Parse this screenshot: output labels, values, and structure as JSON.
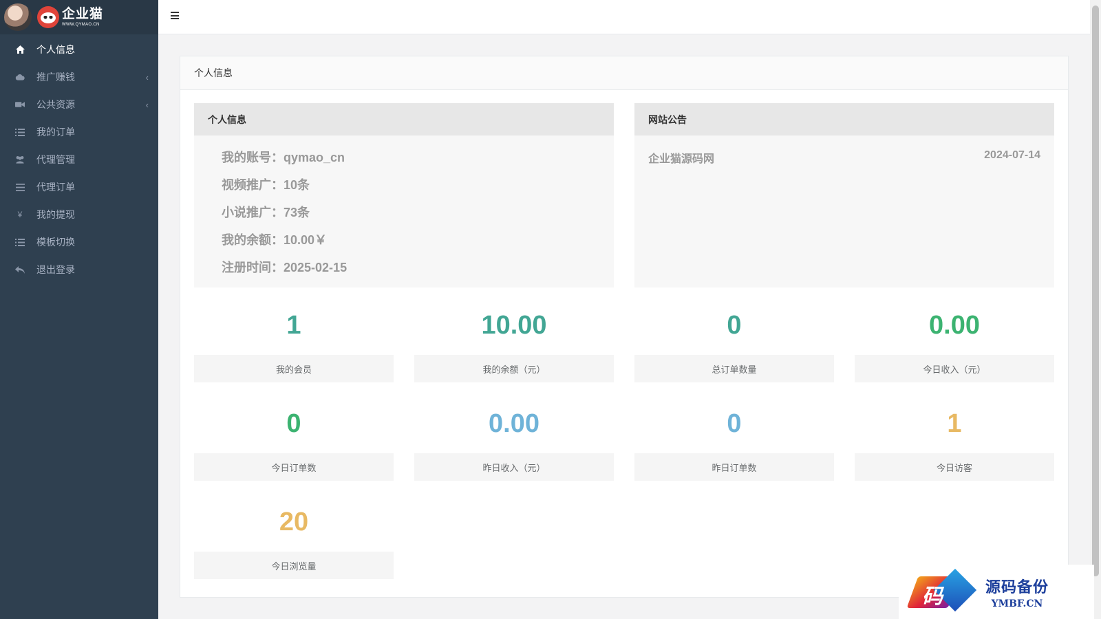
{
  "brand": {
    "name": "企业猫",
    "domain": "WWW.QYMAO.CN"
  },
  "sidebar": {
    "items": [
      {
        "label": "个人信息",
        "icon": "home-icon",
        "active": true
      },
      {
        "label": "推广赚钱",
        "icon": "cloud-icon",
        "has_submenu": true
      },
      {
        "label": "公共资源",
        "icon": "video-camera-icon",
        "has_submenu": true
      },
      {
        "label": "我的订单",
        "icon": "list-icon"
      },
      {
        "label": "代理管理",
        "icon": "users-icon"
      },
      {
        "label": "代理订单",
        "icon": "bars-icon"
      },
      {
        "label": "我的提现",
        "icon": "yen-icon"
      },
      {
        "label": "模板切换",
        "icon": "list-icon"
      },
      {
        "label": "退出登录",
        "icon": "reply-icon"
      }
    ]
  },
  "panel": {
    "title": "个人信息"
  },
  "profile": {
    "title": "个人信息",
    "rows": [
      "我的账号：qymao_cn",
      "视频推广：10条",
      "小说推广：73条",
      "我的余额：10.00￥",
      "注册时间：2025-02-15"
    ]
  },
  "notice": {
    "title": "网站公告",
    "items": [
      {
        "text": "企业猫源码网",
        "date": "2024-07-14"
      }
    ]
  },
  "stats": [
    {
      "value": "1",
      "label": "我的会员",
      "color": "#42a694"
    },
    {
      "value": "10.00",
      "label": "我的余额（元）",
      "color": "#42a694"
    },
    {
      "value": "0",
      "label": "总订单数量",
      "color": "#42a694"
    },
    {
      "value": "0.00",
      "label": "今日收入（元）",
      "color": "#3cb371"
    },
    {
      "value": "0",
      "label": "今日订单数",
      "color": "#3cb371"
    },
    {
      "value": "0.00",
      "label": "昨日收入（元）",
      "color": "#6fb3d8"
    },
    {
      "value": "0",
      "label": "昨日订单数",
      "color": "#6fb3d8"
    },
    {
      "value": "1",
      "label": "今日访客",
      "color": "#e8b963"
    },
    {
      "value": "20",
      "label": "今日浏览量",
      "color": "#e8b963"
    }
  ],
  "watermark": {
    "glyph": "码",
    "name": "源码备份",
    "domain": "YMBF.CN"
  }
}
